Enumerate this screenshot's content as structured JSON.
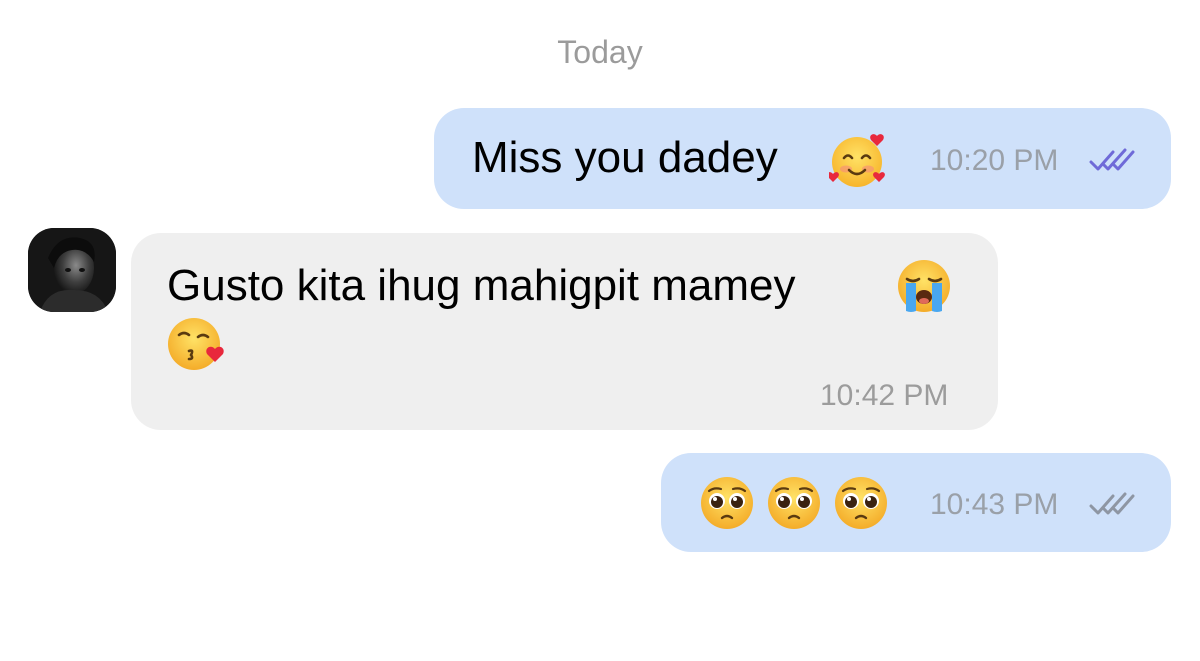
{
  "date_separator": "Today",
  "messages": [
    {
      "direction": "outgoing",
      "text": "Miss you dadey",
      "emoji": [
        "smiling-face-with-hearts"
      ],
      "time": "10:20 PM",
      "status": "read",
      "status_color": "#6f6ad8"
    },
    {
      "direction": "incoming",
      "text": "Gusto kita ihug mahigpit mamey",
      "emoji": [
        "loudly-crying-face",
        "face-blowing-a-kiss"
      ],
      "time": "10:42 PM"
    },
    {
      "direction": "outgoing",
      "text": "",
      "emoji": [
        "pleading-face",
        "pleading-face",
        "pleading-face"
      ],
      "time": "10:43 PM",
      "status": "delivered",
      "status_color": "#8e96a3"
    }
  ],
  "colors": {
    "outgoing_bubble": "#cfe1fa",
    "incoming_bubble": "#efefef",
    "timestamp": "#9aa0a8",
    "date_separator": "#9b9b9b"
  }
}
